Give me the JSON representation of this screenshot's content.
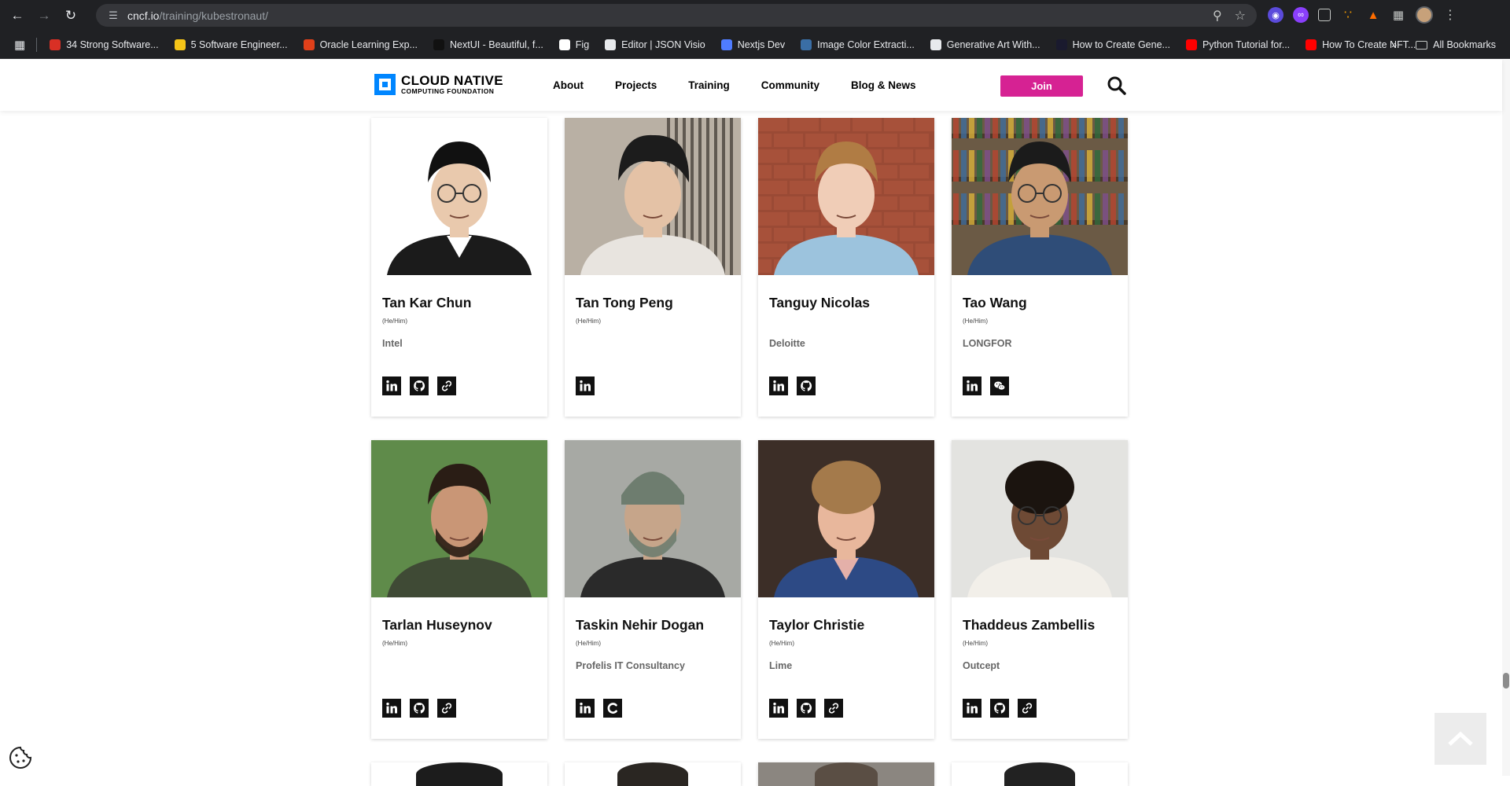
{
  "browser": {
    "url_host": "cncf.io",
    "url_path": "/training/kubestronaut/",
    "bookmarks": [
      {
        "label": "34 Strong Software...",
        "color": "#d93025"
      },
      {
        "label": "5 Software Engineer...",
        "color": "#f5c518"
      },
      {
        "label": "Oracle Learning Exp...",
        "color": "#e0401a"
      },
      {
        "label": "NextUI - Beautiful, f...",
        "color": "#111111"
      },
      {
        "label": "Fig",
        "color": "#ffffff"
      },
      {
        "label": "Editor | JSON Visio",
        "color": "#e8eaed"
      },
      {
        "label": "Nextjs Dev",
        "color": "#4f7cff"
      },
      {
        "label": "Image Color Extracti...",
        "color": "#3a6ea5"
      },
      {
        "label": "Generative Art With...",
        "color": "#e8eaed"
      },
      {
        "label": "How to Create Gene...",
        "color": "#1a1a2e"
      },
      {
        "label": "Python Tutorial for...",
        "color": "#ff0000"
      },
      {
        "label": "How To Create NFT...",
        "color": "#ff0000"
      }
    ],
    "all_bookmarks": "All Bookmarks"
  },
  "header": {
    "logo_line1": "CLOUD NATIVE",
    "logo_line2": "COMPUTING FOUNDATION",
    "nav": [
      "About",
      "Projects",
      "Training",
      "Community",
      "Blog & News"
    ],
    "join_label": "Join"
  },
  "people": [
    {
      "name": "Tan Kar Chun",
      "pronoun": "(He/Him)",
      "company": "Intel",
      "socials": [
        "linkedin",
        "github",
        "link"
      ]
    },
    {
      "name": "Tan Tong Peng",
      "pronoun": "(He/Him)",
      "company": "",
      "socials": [
        "linkedin"
      ]
    },
    {
      "name": "Tanguy Nicolas",
      "pronoun": "",
      "company": "Deloitte",
      "socials": [
        "linkedin",
        "github"
      ]
    },
    {
      "name": "Tao Wang",
      "pronoun": "(He/Him)",
      "company": "LONGFOR",
      "socials": [
        "linkedin",
        "wechat"
      ]
    },
    {
      "name": "Tarlan Huseynov",
      "pronoun": "(He/Him)",
      "company": "",
      "socials": [
        "linkedin",
        "github",
        "link"
      ]
    },
    {
      "name": "Taskin Nehir Dogan",
      "pronoun": "(He/Him)",
      "company": "Profelis IT Consultancy",
      "socials": [
        "linkedin",
        "credly"
      ]
    },
    {
      "name": "Taylor Christie",
      "pronoun": "(He/Him)",
      "company": "Lime",
      "socials": [
        "linkedin",
        "github",
        "link"
      ]
    },
    {
      "name": "Thaddeus Zambellis",
      "pronoun": "(He/Him)",
      "company": "Outcept",
      "socials": [
        "linkedin",
        "github",
        "link"
      ]
    }
  ],
  "colors": {
    "accent": "#d62293",
    "logo_blue": "#0086ff"
  }
}
